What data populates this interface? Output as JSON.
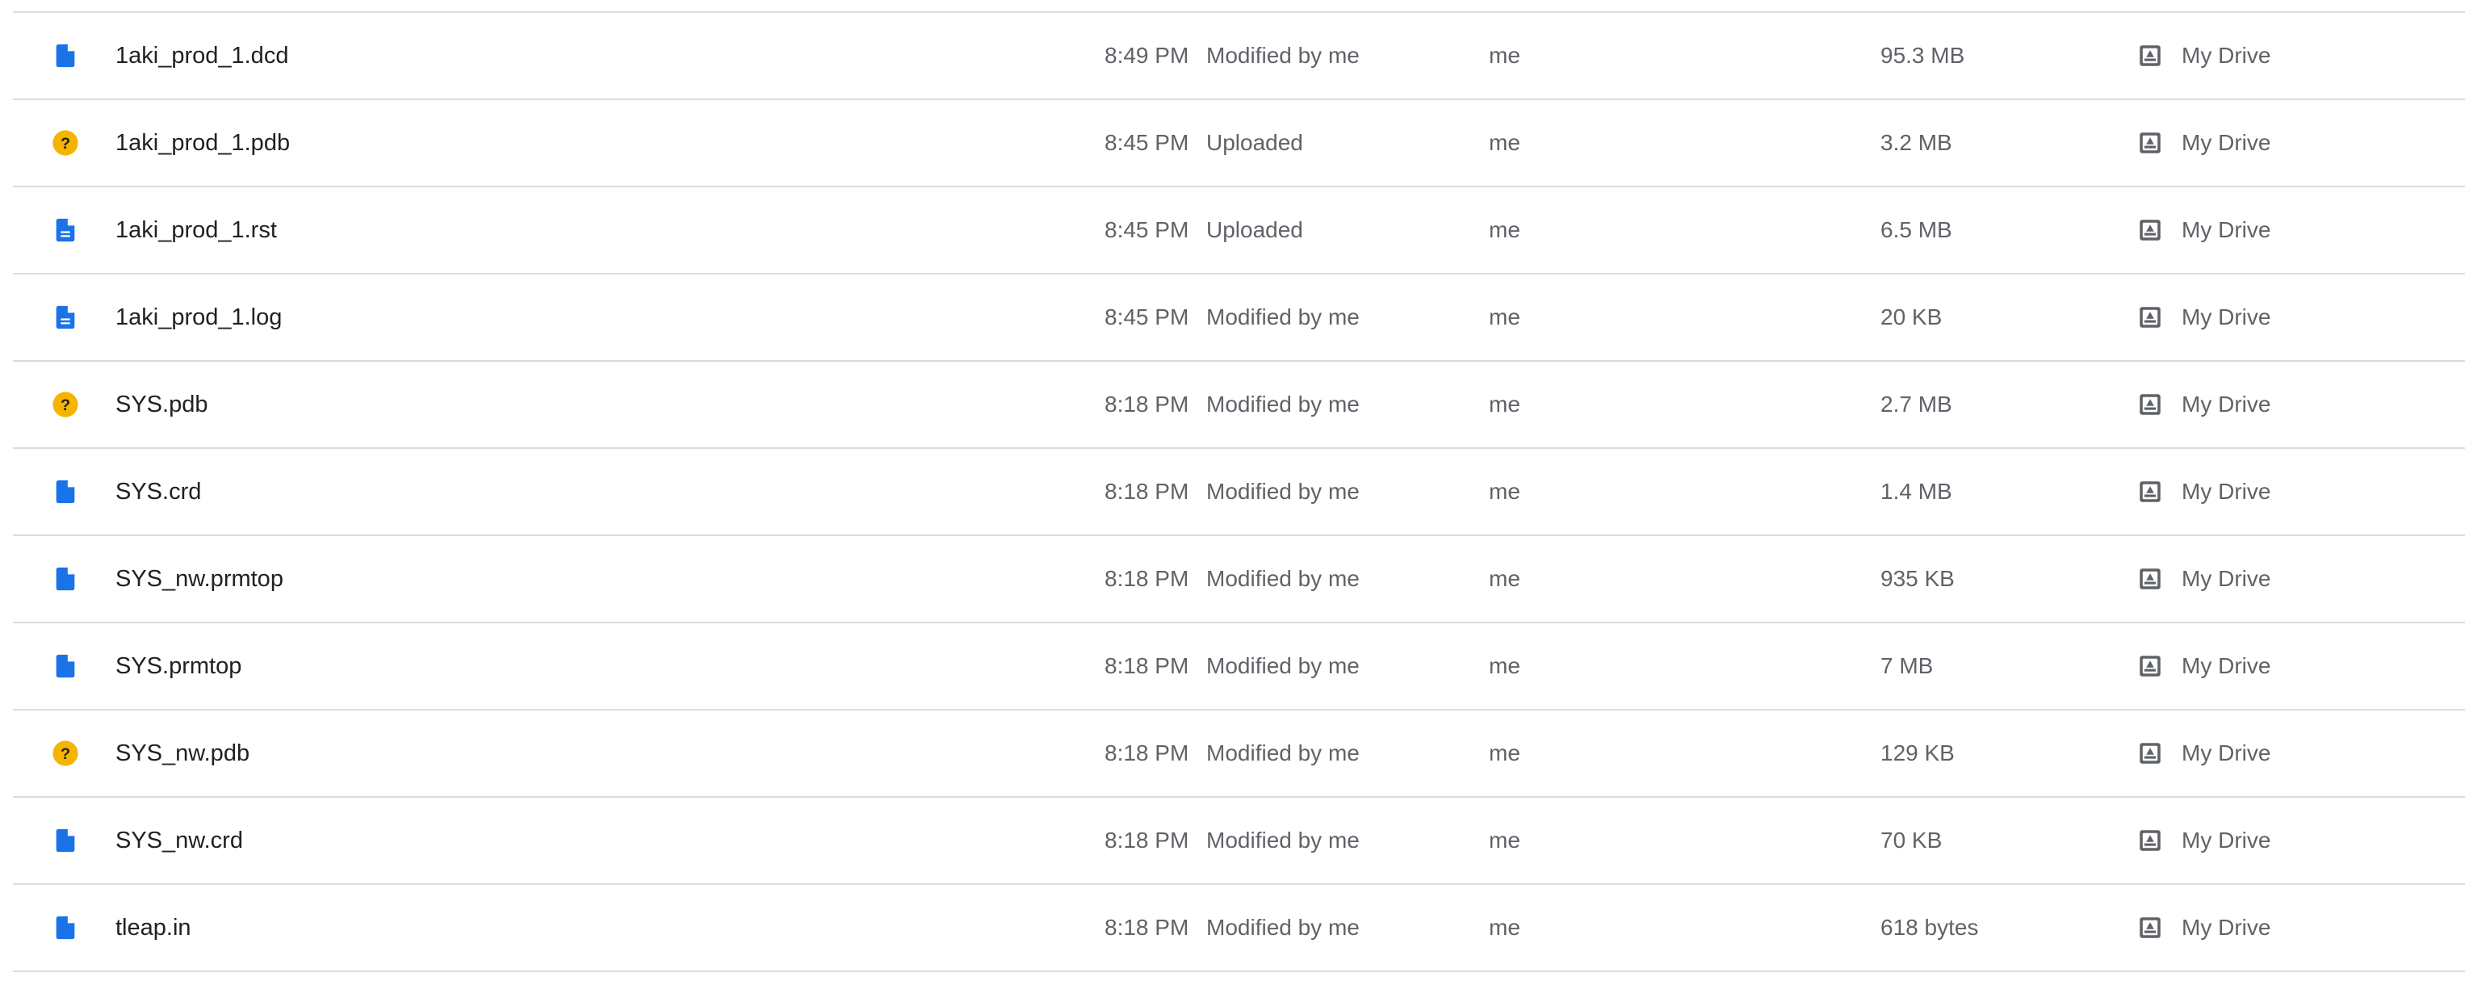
{
  "colors": {
    "doc_blue": "#1a73e8",
    "unknown_yellow": "#f4b400",
    "divider": "#dadce0",
    "primary_text": "#202124",
    "secondary_text": "#5f6368"
  },
  "files": [
    {
      "name": "1aki_prod_1.dcd",
      "icon": "generic-file-icon",
      "time": "8:49 PM",
      "activity": "Modified by me",
      "owner": "me",
      "size": "95.3 MB",
      "location": "My Drive"
    },
    {
      "name": "1aki_prod_1.pdb",
      "icon": "unknown-file-icon",
      "time": "8:45 PM",
      "activity": "Uploaded",
      "owner": "me",
      "size": "3.2 MB",
      "location": "My Drive"
    },
    {
      "name": "1aki_prod_1.rst",
      "icon": "text-file-icon",
      "time": "8:45 PM",
      "activity": "Uploaded",
      "owner": "me",
      "size": "6.5 MB",
      "location": "My Drive"
    },
    {
      "name": "1aki_prod_1.log",
      "icon": "text-file-icon",
      "time": "8:45 PM",
      "activity": "Modified by me",
      "owner": "me",
      "size": "20 KB",
      "location": "My Drive"
    },
    {
      "name": "SYS.pdb",
      "icon": "unknown-file-icon",
      "time": "8:18 PM",
      "activity": "Modified by me",
      "owner": "me",
      "size": "2.7 MB",
      "location": "My Drive"
    },
    {
      "name": "SYS.crd",
      "icon": "generic-file-icon",
      "time": "8:18 PM",
      "activity": "Modified by me",
      "owner": "me",
      "size": "1.4 MB",
      "location": "My Drive"
    },
    {
      "name": "SYS_nw.prmtop",
      "icon": "generic-file-icon",
      "time": "8:18 PM",
      "activity": "Modified by me",
      "owner": "me",
      "size": "935 KB",
      "location": "My Drive"
    },
    {
      "name": "SYS.prmtop",
      "icon": "generic-file-icon",
      "time": "8:18 PM",
      "activity": "Modified by me",
      "owner": "me",
      "size": "7 MB",
      "location": "My Drive"
    },
    {
      "name": "SYS_nw.pdb",
      "icon": "unknown-file-icon",
      "time": "8:18 PM",
      "activity": "Modified by me",
      "owner": "me",
      "size": "129 KB",
      "location": "My Drive"
    },
    {
      "name": "SYS_nw.crd",
      "icon": "generic-file-icon",
      "time": "8:18 PM",
      "activity": "Modified by me",
      "owner": "me",
      "size": "70 KB",
      "location": "My Drive"
    },
    {
      "name": "tleap.in",
      "icon": "generic-file-icon",
      "time": "8:18 PM",
      "activity": "Modified by me",
      "owner": "me",
      "size": "618 bytes",
      "location": "My Drive"
    }
  ],
  "location_icon": "my-drive-icon"
}
